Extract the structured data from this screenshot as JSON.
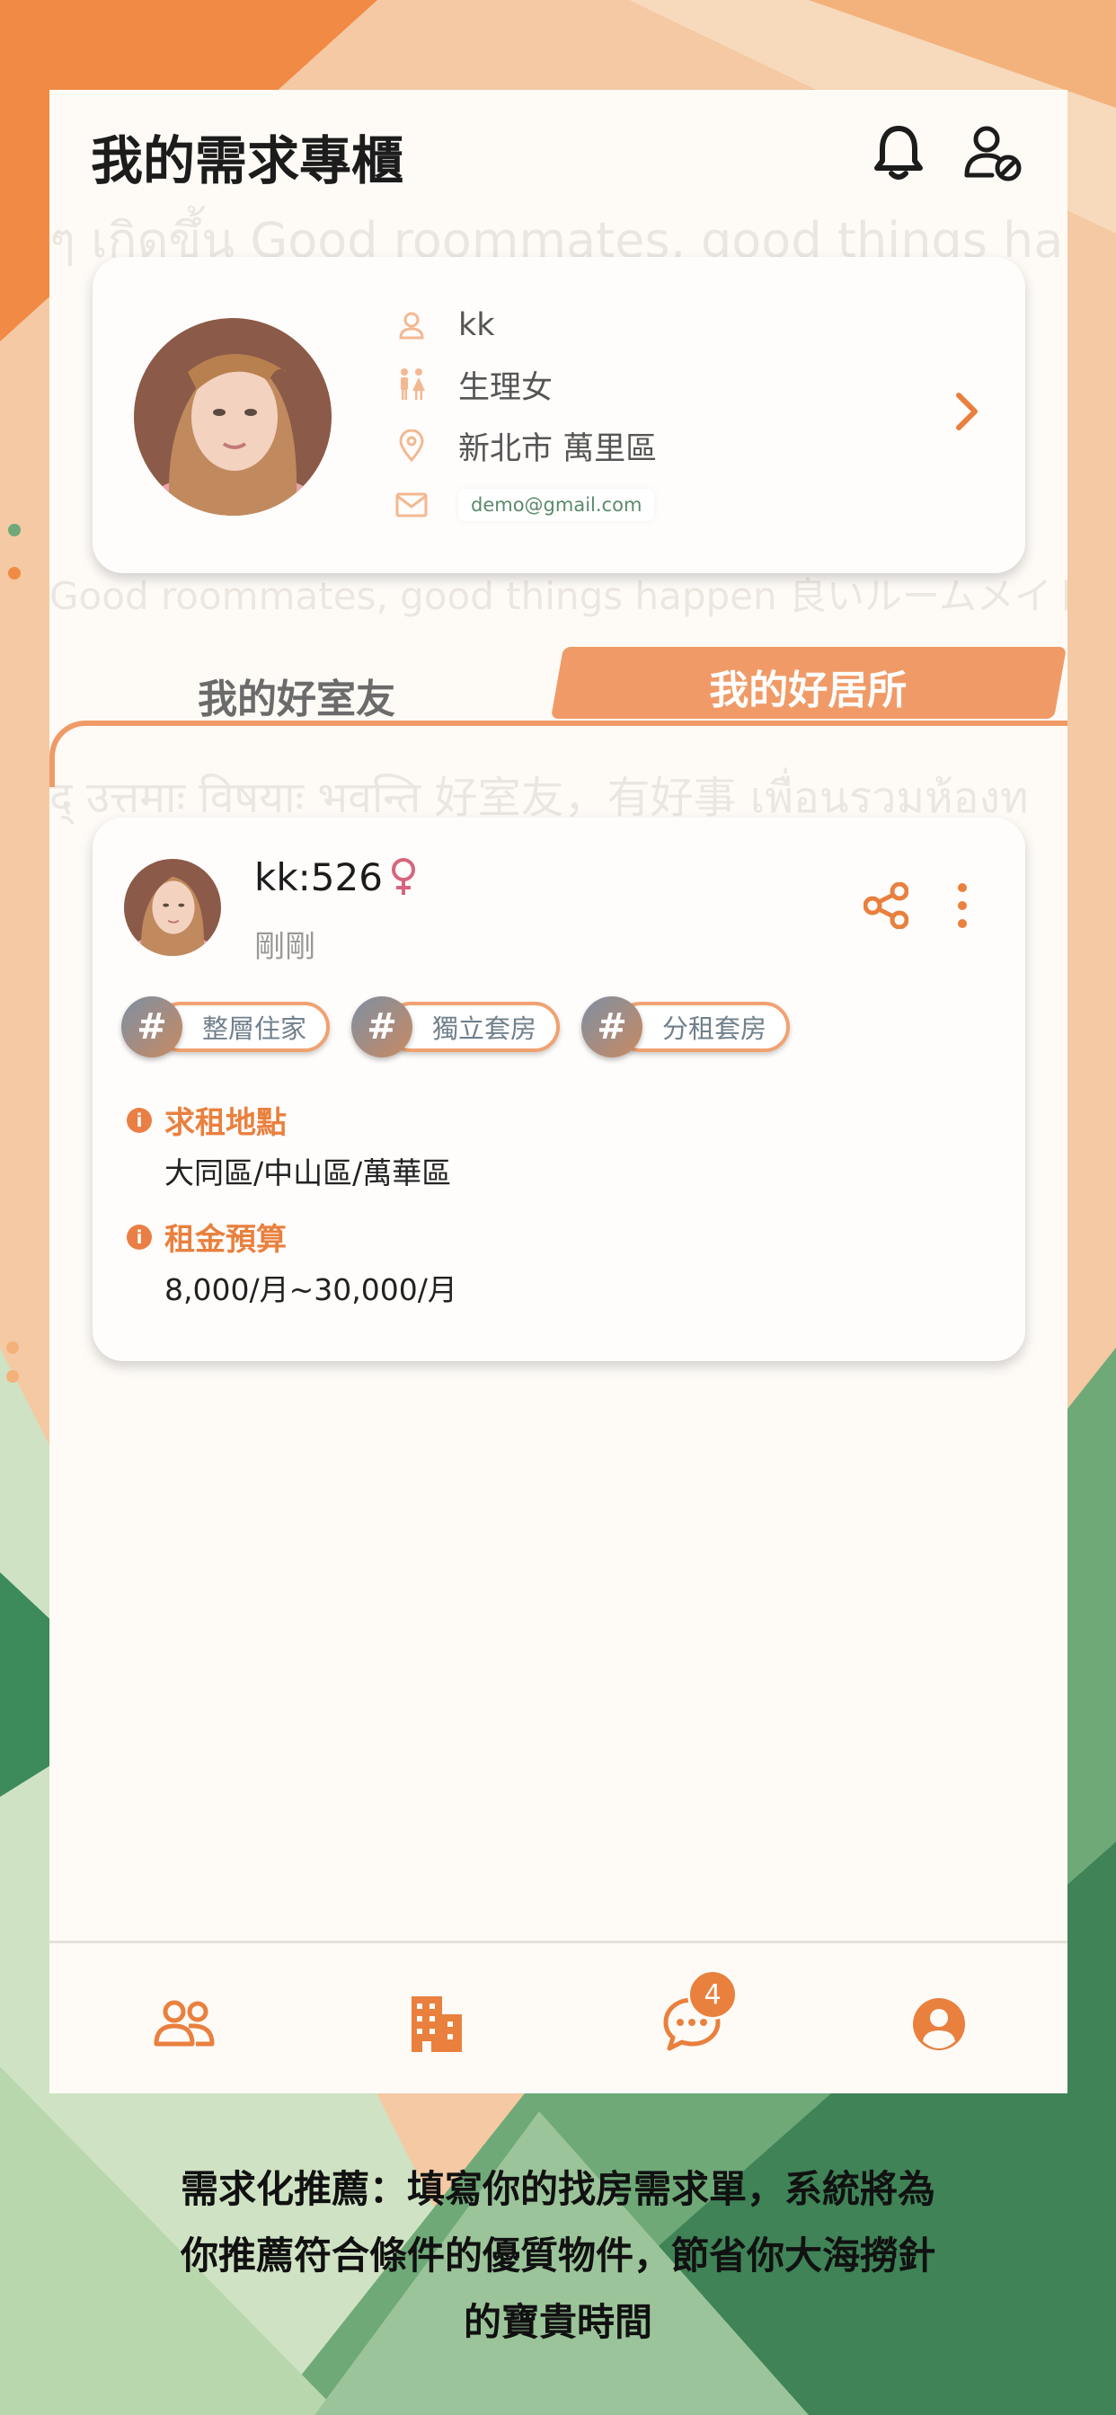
{
  "header": {
    "title": "我的需求專櫃"
  },
  "watermarks": [
    "ๆ เกิดขึ้น Good roommates, good things ha",
    "Good roommates, good things happen 良いルームメイト",
    "द् उत्तमाः विषयाः भवन्ति  好室友，有好事 เพื่อนรวมห้องท"
  ],
  "profile": {
    "name": "kk",
    "gender": "生理女",
    "location": "新北市 萬里區",
    "email": "demo@gmail.com"
  },
  "tabs": [
    {
      "label": "我的好室友",
      "active": false
    },
    {
      "label": "我的好居所",
      "active": true
    }
  ],
  "demand": {
    "username": "kk:526",
    "time": "剛剛",
    "tags": [
      "整層住家",
      "獨立套房",
      "分租套房"
    ],
    "sections": [
      {
        "title": "求租地點",
        "value": "大同區/中山區/萬華區"
      },
      {
        "title": "租金預算",
        "value": "8,000/月~30,000/月"
      }
    ]
  },
  "nav": {
    "items": [
      "roommates-icon",
      "building-icon",
      "chat-icon",
      "profile-icon"
    ],
    "chat_badge": "4"
  },
  "caption": {
    "line1": "需求化推薦：填寫你的找房需求單，系統將為",
    "line2": "你推薦符合條件的優質物件，節省你大海撈針",
    "line3": "的寶貴時間"
  },
  "colors": {
    "accent": "#f09b67",
    "accent_dark": "#e9803e",
    "bg": "#fefbf7",
    "green": "#5f9e6f"
  }
}
